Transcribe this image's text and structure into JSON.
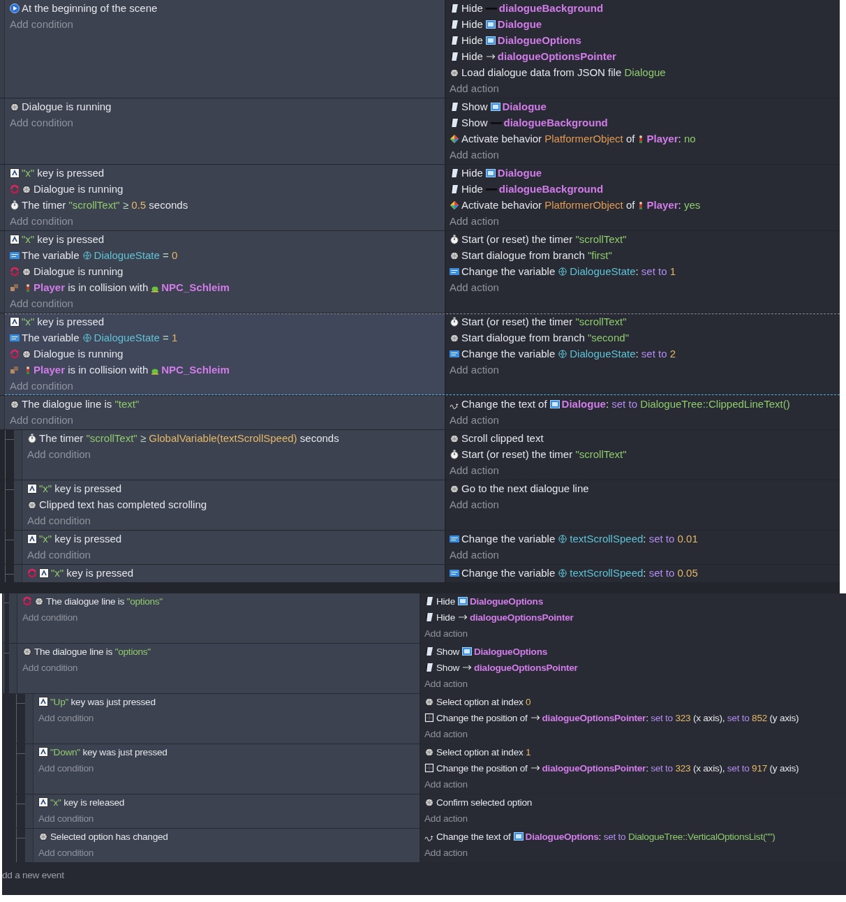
{
  "panels": [
    {
      "events": [
        {
          "selected": false,
          "conditions": [
            {
              "kind": "scene-start",
              "inverted": false,
              "parts": [
                {
                  "kind": "plain",
                  "text": "At the beginning of the scene"
                }
              ]
            }
          ],
          "add_condition": "Add condition",
          "actions": [
            {
              "kind": "visibility",
              "parts": [
                {
                  "kind": "plain",
                  "text": "Hide"
                },
                {
                  "kind": "shape",
                  "text": "dialogueBackground"
                }
              ]
            },
            {
              "kind": "visibility",
              "parts": [
                {
                  "kind": "plain",
                  "text": "Hide"
                },
                {
                  "kind": "text",
                  "text": "Dialogue"
                }
              ]
            },
            {
              "kind": "visibility",
              "parts": [
                {
                  "kind": "plain",
                  "text": "Hide"
                },
                {
                  "kind": "text",
                  "text": "DialogueOptions"
                }
              ]
            },
            {
              "kind": "visibility",
              "parts": [
                {
                  "kind": "plain",
                  "text": "Hide"
                },
                {
                  "kind": "pointer",
                  "text": "dialogueOptionsPointer"
                }
              ]
            },
            {
              "kind": "dialogue",
              "parts": [
                {
                  "kind": "plain",
                  "text": "Load dialogue data from JSON file"
                },
                {
                  "kind": "string",
                  "text": "Dialogue"
                }
              ]
            }
          ],
          "add_action": "Add action"
        },
        {
          "selected": false,
          "conditions": [
            {
              "kind": "dialogue",
              "inverted": false,
              "parts": [
                {
                  "kind": "plain",
                  "text": "Dialogue is running"
                }
              ]
            }
          ],
          "add_condition": "Add condition",
          "actions": [
            {
              "kind": "visibility",
              "parts": [
                {
                  "kind": "plain",
                  "text": "Show"
                },
                {
                  "kind": "text",
                  "text": "Dialogue"
                }
              ]
            },
            {
              "kind": "visibility",
              "parts": [
                {
                  "kind": "plain",
                  "text": "Show"
                },
                {
                  "kind": "shape",
                  "text": "dialogueBackground"
                }
              ]
            },
            {
              "kind": "behavior",
              "parts": [
                {
                  "kind": "plain",
                  "text": "Activate behavior"
                },
                {
                  "kind": "behavior",
                  "text": "PlatformerObject"
                },
                {
                  "kind": "plain",
                  "text": "of"
                },
                {
                  "kind": "player",
                  "text": "Player"
                },
                {
                  "kind": "plain",
                  "text": ":",
                  "attached": true
                },
                {
                  "kind": "string",
                  "text": "no"
                }
              ]
            }
          ],
          "add_action": "Add action"
        },
        {
          "selected": false,
          "conditions": [
            {
              "kind": "keyboard",
              "inverted": false,
              "parts": [
                {
                  "kind": "string",
                  "text": "\"x\""
                },
                {
                  "kind": "plain",
                  "text": "key is pressed"
                }
              ]
            },
            {
              "kind": "dialogue",
              "inverted": true,
              "parts": [
                {
                  "kind": "plain",
                  "text": "Dialogue is running"
                }
              ]
            },
            {
              "kind": "timer",
              "inverted": false,
              "parts": [
                {
                  "kind": "plain",
                  "text": "The timer"
                },
                {
                  "kind": "string",
                  "text": "\"scrollText\""
                },
                {
                  "kind": "operator",
                  "text": "≥"
                },
                {
                  "kind": "number",
                  "text": "0.5"
                },
                {
                  "kind": "plain",
                  "text": "seconds"
                }
              ]
            }
          ],
          "add_condition": "Add condition",
          "actions": [
            {
              "kind": "visibility",
              "parts": [
                {
                  "kind": "plain",
                  "text": "Hide"
                },
                {
                  "kind": "text",
                  "text": "Dialogue"
                }
              ]
            },
            {
              "kind": "visibility",
              "parts": [
                {
                  "kind": "plain",
                  "text": "Hide"
                },
                {
                  "kind": "shape",
                  "text": "dialogueBackground"
                }
              ]
            },
            {
              "kind": "behavior",
              "parts": [
                {
                  "kind": "plain",
                  "text": "Activate behavior"
                },
                {
                  "kind": "behavior",
                  "text": "PlatformerObject"
                },
                {
                  "kind": "plain",
                  "text": "of"
                },
                {
                  "kind": "player",
                  "text": "Player"
                },
                {
                  "kind": "plain",
                  "text": ":",
                  "attached": true
                },
                {
                  "kind": "string",
                  "text": "yes"
                }
              ]
            }
          ],
          "add_action": "Add action"
        },
        {
          "selected": false,
          "conditions": [
            {
              "kind": "keyboard",
              "inverted": false,
              "parts": [
                {
                  "kind": "string",
                  "text": "\"x\""
                },
                {
                  "kind": "plain",
                  "text": "key is pressed"
                }
              ]
            },
            {
              "kind": "variable",
              "inverted": false,
              "parts": [
                {
                  "kind": "plain",
                  "text": "The variable"
                },
                {
                  "kind": "variable",
                  "text": "DialogueState"
                },
                {
                  "kind": "operator",
                  "text": "="
                },
                {
                  "kind": "number",
                  "text": "0"
                }
              ]
            },
            {
              "kind": "dialogue",
              "inverted": true,
              "parts": [
                {
                  "kind": "plain",
                  "text": "Dialogue is running"
                }
              ]
            },
            {
              "kind": "collision",
              "inverted": false,
              "parts": [
                {
                  "kind": "player",
                  "text": "Player"
                },
                {
                  "kind": "plain",
                  "text": "is in collision with"
                },
                {
                  "kind": "npc",
                  "text": "NPC_Schleim"
                }
              ]
            }
          ],
          "add_condition": "Add condition",
          "actions": [
            {
              "kind": "timer",
              "parts": [
                {
                  "kind": "plain",
                  "text": "Start (or reset) the timer"
                },
                {
                  "kind": "string",
                  "text": "\"scrollText\""
                }
              ]
            },
            {
              "kind": "dialogue",
              "parts": [
                {
                  "kind": "plain",
                  "text": "Start dialogue from branch"
                },
                {
                  "kind": "string",
                  "text": "\"first\""
                }
              ]
            },
            {
              "kind": "variable",
              "parts": [
                {
                  "kind": "plain",
                  "text": "Change the variable"
                },
                {
                  "kind": "variable",
                  "text": "DialogueState"
                },
                {
                  "kind": "plain",
                  "text": ":",
                  "attached": true
                },
                {
                  "kind": "keyword",
                  "text": "set to"
                },
                {
                  "kind": "number",
                  "text": "1"
                }
              ]
            }
          ],
          "add_action": "Add action"
        },
        {
          "selected": true,
          "conditions": [
            {
              "kind": "keyboard",
              "inverted": false,
              "parts": [
                {
                  "kind": "string",
                  "text": "\"x\""
                },
                {
                  "kind": "plain",
                  "text": "key is pressed"
                }
              ]
            },
            {
              "kind": "variable",
              "inverted": false,
              "parts": [
                {
                  "kind": "plain",
                  "text": "The variable"
                },
                {
                  "kind": "variable",
                  "text": "DialogueState"
                },
                {
                  "kind": "operator",
                  "text": "="
                },
                {
                  "kind": "number",
                  "text": "1"
                }
              ]
            },
            {
              "kind": "dialogue",
              "inverted": true,
              "parts": [
                {
                  "kind": "plain",
                  "text": "Dialogue is running"
                }
              ]
            },
            {
              "kind": "collision",
              "inverted": false,
              "parts": [
                {
                  "kind": "player",
                  "text": "Player"
                },
                {
                  "kind": "plain",
                  "text": "is in collision with"
                },
                {
                  "kind": "npc",
                  "text": "NPC_Schleim"
                }
              ]
            }
          ],
          "add_condition": "Add condition",
          "actions": [
            {
              "kind": "timer",
              "parts": [
                {
                  "kind": "plain",
                  "text": "Start (or reset) the timer"
                },
                {
                  "kind": "string",
                  "text": "\"scrollText\""
                }
              ]
            },
            {
              "kind": "dialogue",
              "parts": [
                {
                  "kind": "plain",
                  "text": "Start dialogue from branch"
                },
                {
                  "kind": "string",
                  "text": "\"second\""
                }
              ]
            },
            {
              "kind": "variable",
              "parts": [
                {
                  "kind": "plain",
                  "text": "Change the variable"
                },
                {
                  "kind": "variable",
                  "text": "DialogueState"
                },
                {
                  "kind": "plain",
                  "text": ":",
                  "attached": true
                },
                {
                  "kind": "keyword",
                  "text": "set to"
                },
                {
                  "kind": "number",
                  "text": "2"
                }
              ]
            }
          ],
          "add_action": "Add action"
        },
        {
          "selected": false,
          "conditions": [
            {
              "kind": "dialogue",
              "inverted": false,
              "parts": [
                {
                  "kind": "plain",
                  "text": "The dialogue line is"
                },
                {
                  "kind": "string",
                  "text": "\"text\""
                }
              ]
            }
          ],
          "add_condition": "Add condition",
          "actions": [
            {
              "kind": "text",
              "parts": [
                {
                  "kind": "plain",
                  "text": "Change the text of"
                },
                {
                  "kind": "text",
                  "text": "Dialogue"
                },
                {
                  "kind": "plain",
                  "text": ":",
                  "attached": true
                },
                {
                  "kind": "keyword",
                  "text": "set to"
                },
                {
                  "kind": "string",
                  "text": "DialogueTree::ClippedLineText()"
                }
              ]
            }
          ],
          "add_action": "Add action",
          "children": [
            {
              "selected": false,
              "conditions": [
                {
                  "kind": "timer",
                  "inverted": false,
                  "parts": [
                    {
                      "kind": "plain",
                      "text": "The timer"
                    },
                    {
                      "kind": "string",
                      "text": "\"scrollText\""
                    },
                    {
                      "kind": "operator",
                      "text": "≥"
                    },
                    {
                      "kind": "number",
                      "text": "GlobalVariable(textScrollSpeed)"
                    },
                    {
                      "kind": "plain",
                      "text": "seconds"
                    }
                  ]
                }
              ],
              "add_condition": "Add condition",
              "actions": [
                {
                  "kind": "dialogue",
                  "parts": [
                    {
                      "kind": "plain",
                      "text": "Scroll clipped text"
                    }
                  ]
                },
                {
                  "kind": "timer",
                  "parts": [
                    {
                      "kind": "plain",
                      "text": "Start (or reset) the timer"
                    },
                    {
                      "kind": "string",
                      "text": "\"scrollText\""
                    }
                  ]
                }
              ],
              "add_action": "Add action"
            },
            {
              "selected": false,
              "conditions": [
                {
                  "kind": "keyboard",
                  "inverted": false,
                  "parts": [
                    {
                      "kind": "string",
                      "text": "\"x\""
                    },
                    {
                      "kind": "plain",
                      "text": "key is pressed"
                    }
                  ]
                },
                {
                  "kind": "dialogue",
                  "inverted": false,
                  "parts": [
                    {
                      "kind": "plain",
                      "text": "Clipped text has completed scrolling"
                    }
                  ]
                }
              ],
              "add_condition": "Add condition",
              "actions": [
                {
                  "kind": "dialogue",
                  "parts": [
                    {
                      "kind": "plain",
                      "text": "Go to the next dialogue line"
                    }
                  ]
                }
              ],
              "add_action": "Add action"
            },
            {
              "selected": false,
              "conditions": [
                {
                  "kind": "keyboard",
                  "inverted": false,
                  "parts": [
                    {
                      "kind": "string",
                      "text": "\"x\""
                    },
                    {
                      "kind": "plain",
                      "text": "key is pressed"
                    }
                  ]
                }
              ],
              "add_condition": "Add condition",
              "actions": [
                {
                  "kind": "variable",
                  "parts": [
                    {
                      "kind": "plain",
                      "text": "Change the variable"
                    },
                    {
                      "kind": "variable",
                      "text": "textScrollSpeed"
                    },
                    {
                      "kind": "plain",
                      "text": ":",
                      "attached": true
                    },
                    {
                      "kind": "keyword",
                      "text": "set to"
                    },
                    {
                      "kind": "number",
                      "text": "0.01"
                    }
                  ]
                }
              ],
              "add_action": "Add action"
            },
            {
              "selected": false,
              "conditions": [
                {
                  "kind": "keyboard",
                  "inverted": true,
                  "parts": [
                    {
                      "kind": "string",
                      "text": "\"x\""
                    },
                    {
                      "kind": "plain",
                      "text": "key is pressed"
                    }
                  ]
                }
              ],
              "actions": [
                {
                  "kind": "variable",
                  "parts": [
                    {
                      "kind": "plain",
                      "text": "Change the variable"
                    },
                    {
                      "kind": "variable",
                      "text": "textScrollSpeed"
                    },
                    {
                      "kind": "plain",
                      "text": ":",
                      "attached": true
                    },
                    {
                      "kind": "keyword",
                      "text": "set to"
                    },
                    {
                      "kind": "number",
                      "text": "0.05"
                    }
                  ]
                }
              ]
            }
          ]
        }
      ]
    },
    {
      "events": [
        {
          "selected": false,
          "conditions": [
            {
              "kind": "dialogue",
              "inverted": true,
              "parts": [
                {
                  "kind": "plain",
                  "text": "The dialogue line is"
                },
                {
                  "kind": "string",
                  "text": "\"options\""
                }
              ]
            }
          ],
          "add_condition": "Add condition",
          "actions": [
            {
              "kind": "visibility",
              "parts": [
                {
                  "kind": "plain",
                  "text": "Hide"
                },
                {
                  "kind": "text",
                  "text": "DialogueOptions"
                }
              ]
            },
            {
              "kind": "visibility",
              "parts": [
                {
                  "kind": "plain",
                  "text": "Hide"
                },
                {
                  "kind": "pointer",
                  "text": "dialogueOptionsPointer"
                }
              ]
            }
          ],
          "add_action": "Add action"
        },
        {
          "selected": false,
          "conditions": [
            {
              "kind": "dialogue",
              "inverted": false,
              "parts": [
                {
                  "kind": "plain",
                  "text": "The dialogue line is"
                },
                {
                  "kind": "string",
                  "text": "\"options\""
                }
              ]
            }
          ],
          "add_condition": "Add condition",
          "actions": [
            {
              "kind": "visibility",
              "parts": [
                {
                  "kind": "plain",
                  "text": "Show"
                },
                {
                  "kind": "text",
                  "text": "DialogueOptions"
                }
              ]
            },
            {
              "kind": "visibility",
              "parts": [
                {
                  "kind": "plain",
                  "text": "Show"
                },
                {
                  "kind": "pointer",
                  "text": "dialogueOptionsPointer"
                }
              ]
            }
          ],
          "add_action": "Add action",
          "children": [
            {
              "selected": false,
              "conditions": [
                {
                  "kind": "keyboard",
                  "inverted": false,
                  "parts": [
                    {
                      "kind": "string",
                      "text": "\"Up\""
                    },
                    {
                      "kind": "plain",
                      "text": "key was just pressed"
                    }
                  ]
                }
              ],
              "add_condition": "Add condition",
              "actions": [
                {
                  "kind": "dialogue",
                  "parts": [
                    {
                      "kind": "plain",
                      "text": "Select option at index"
                    },
                    {
                      "kind": "number",
                      "text": "0"
                    }
                  ]
                },
                {
                  "kind": "position",
                  "parts": [
                    {
                      "kind": "plain",
                      "text": "Change the position of"
                    },
                    {
                      "kind": "pointer",
                      "text": "dialogueOptionsPointer"
                    },
                    {
                      "kind": "plain",
                      "text": ":",
                      "attached": true
                    },
                    {
                      "kind": "keyword",
                      "text": "set to"
                    },
                    {
                      "kind": "number",
                      "text": "323"
                    },
                    {
                      "kind": "plain",
                      "text": "(x axis),"
                    },
                    {
                      "kind": "keyword",
                      "text": "set to"
                    },
                    {
                      "kind": "number",
                      "text": "852"
                    },
                    {
                      "kind": "plain",
                      "text": "(y axis)"
                    }
                  ]
                }
              ],
              "add_action": "Add action"
            },
            {
              "selected": false,
              "conditions": [
                {
                  "kind": "keyboard",
                  "inverted": false,
                  "parts": [
                    {
                      "kind": "string",
                      "text": "\"Down\""
                    },
                    {
                      "kind": "plain",
                      "text": "key was just pressed"
                    }
                  ]
                }
              ],
              "add_condition": "Add condition",
              "actions": [
                {
                  "kind": "dialogue",
                  "parts": [
                    {
                      "kind": "plain",
                      "text": "Select option at index"
                    },
                    {
                      "kind": "number",
                      "text": "1"
                    }
                  ]
                },
                {
                  "kind": "position",
                  "parts": [
                    {
                      "kind": "plain",
                      "text": "Change the position of"
                    },
                    {
                      "kind": "pointer",
                      "text": "dialogueOptionsPointer"
                    },
                    {
                      "kind": "plain",
                      "text": ":",
                      "attached": true
                    },
                    {
                      "kind": "keyword",
                      "text": "set to"
                    },
                    {
                      "kind": "number",
                      "text": "323"
                    },
                    {
                      "kind": "plain",
                      "text": "(x axis),"
                    },
                    {
                      "kind": "keyword",
                      "text": "set to"
                    },
                    {
                      "kind": "number",
                      "text": "917"
                    },
                    {
                      "kind": "plain",
                      "text": "(y axis)"
                    }
                  ]
                }
              ],
              "add_action": "Add action"
            },
            {
              "selected": false,
              "conditions": [
                {
                  "kind": "keyboard",
                  "inverted": false,
                  "parts": [
                    {
                      "kind": "string",
                      "text": "\"x\""
                    },
                    {
                      "kind": "plain",
                      "text": "key is released"
                    }
                  ]
                }
              ],
              "add_condition": "Add condition",
              "actions": [
                {
                  "kind": "dialogue",
                  "parts": [
                    {
                      "kind": "plain",
                      "text": "Confirm selected option"
                    }
                  ]
                }
              ],
              "add_action": "Add action"
            },
            {
              "selected": false,
              "conditions": [
                {
                  "kind": "dialogue",
                  "inverted": false,
                  "parts": [
                    {
                      "kind": "plain",
                      "text": "Selected option has changed"
                    }
                  ]
                }
              ],
              "add_condition": "Add condition",
              "actions": [
                {
                  "kind": "text",
                  "parts": [
                    {
                      "kind": "plain",
                      "text": "Change the text of"
                    },
                    {
                      "kind": "text",
                      "text": "DialogueOptions"
                    },
                    {
                      "kind": "plain",
                      "text": ":",
                      "attached": true
                    },
                    {
                      "kind": "keyword",
                      "text": "set to"
                    },
                    {
                      "kind": "string",
                      "text": "DialogueTree::VerticalOptionsList(\"\")"
                    }
                  ]
                }
              ],
              "add_action": "Add action"
            }
          ]
        }
      ],
      "add_event": "dd a new event"
    }
  ]
}
